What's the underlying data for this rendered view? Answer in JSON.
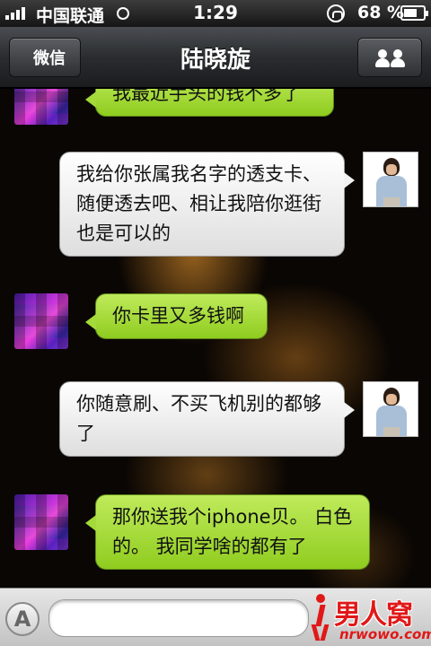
{
  "status_bar": {
    "carrier": "中国联通",
    "time": "1:29",
    "battery_percent": "68 %",
    "battery_level": 0.68
  },
  "nav": {
    "back_label": "微信",
    "title": "陆晓旋",
    "right_icon": "contacts-icon"
  },
  "messages": [
    {
      "side": "left",
      "text": "我最近手头的钱不多了"
    },
    {
      "side": "right",
      "text": "我给你张属我名字的透支卡、随便透去吧、相让我陪你逛街也是可以的"
    },
    {
      "side": "left",
      "text": "你卡里又多钱啊"
    },
    {
      "side": "right",
      "text": "你随意刷、不买飞机别的都够了"
    },
    {
      "side": "left",
      "text": "那你送我个iphone贝。 白色的。 我同学啥的都有了"
    }
  ],
  "input_bar": {
    "voice_button_label": "A",
    "input_value": "",
    "input_placeholder": ""
  },
  "watermark": {
    "text": "男人窝",
    "url": "nrwowo.com"
  },
  "colors": {
    "incoming_bubble": "#a4d93a",
    "outgoing_bubble": "#f2f2f2",
    "nav_bar": "#2a2c2f",
    "watermark": "#e01818"
  }
}
